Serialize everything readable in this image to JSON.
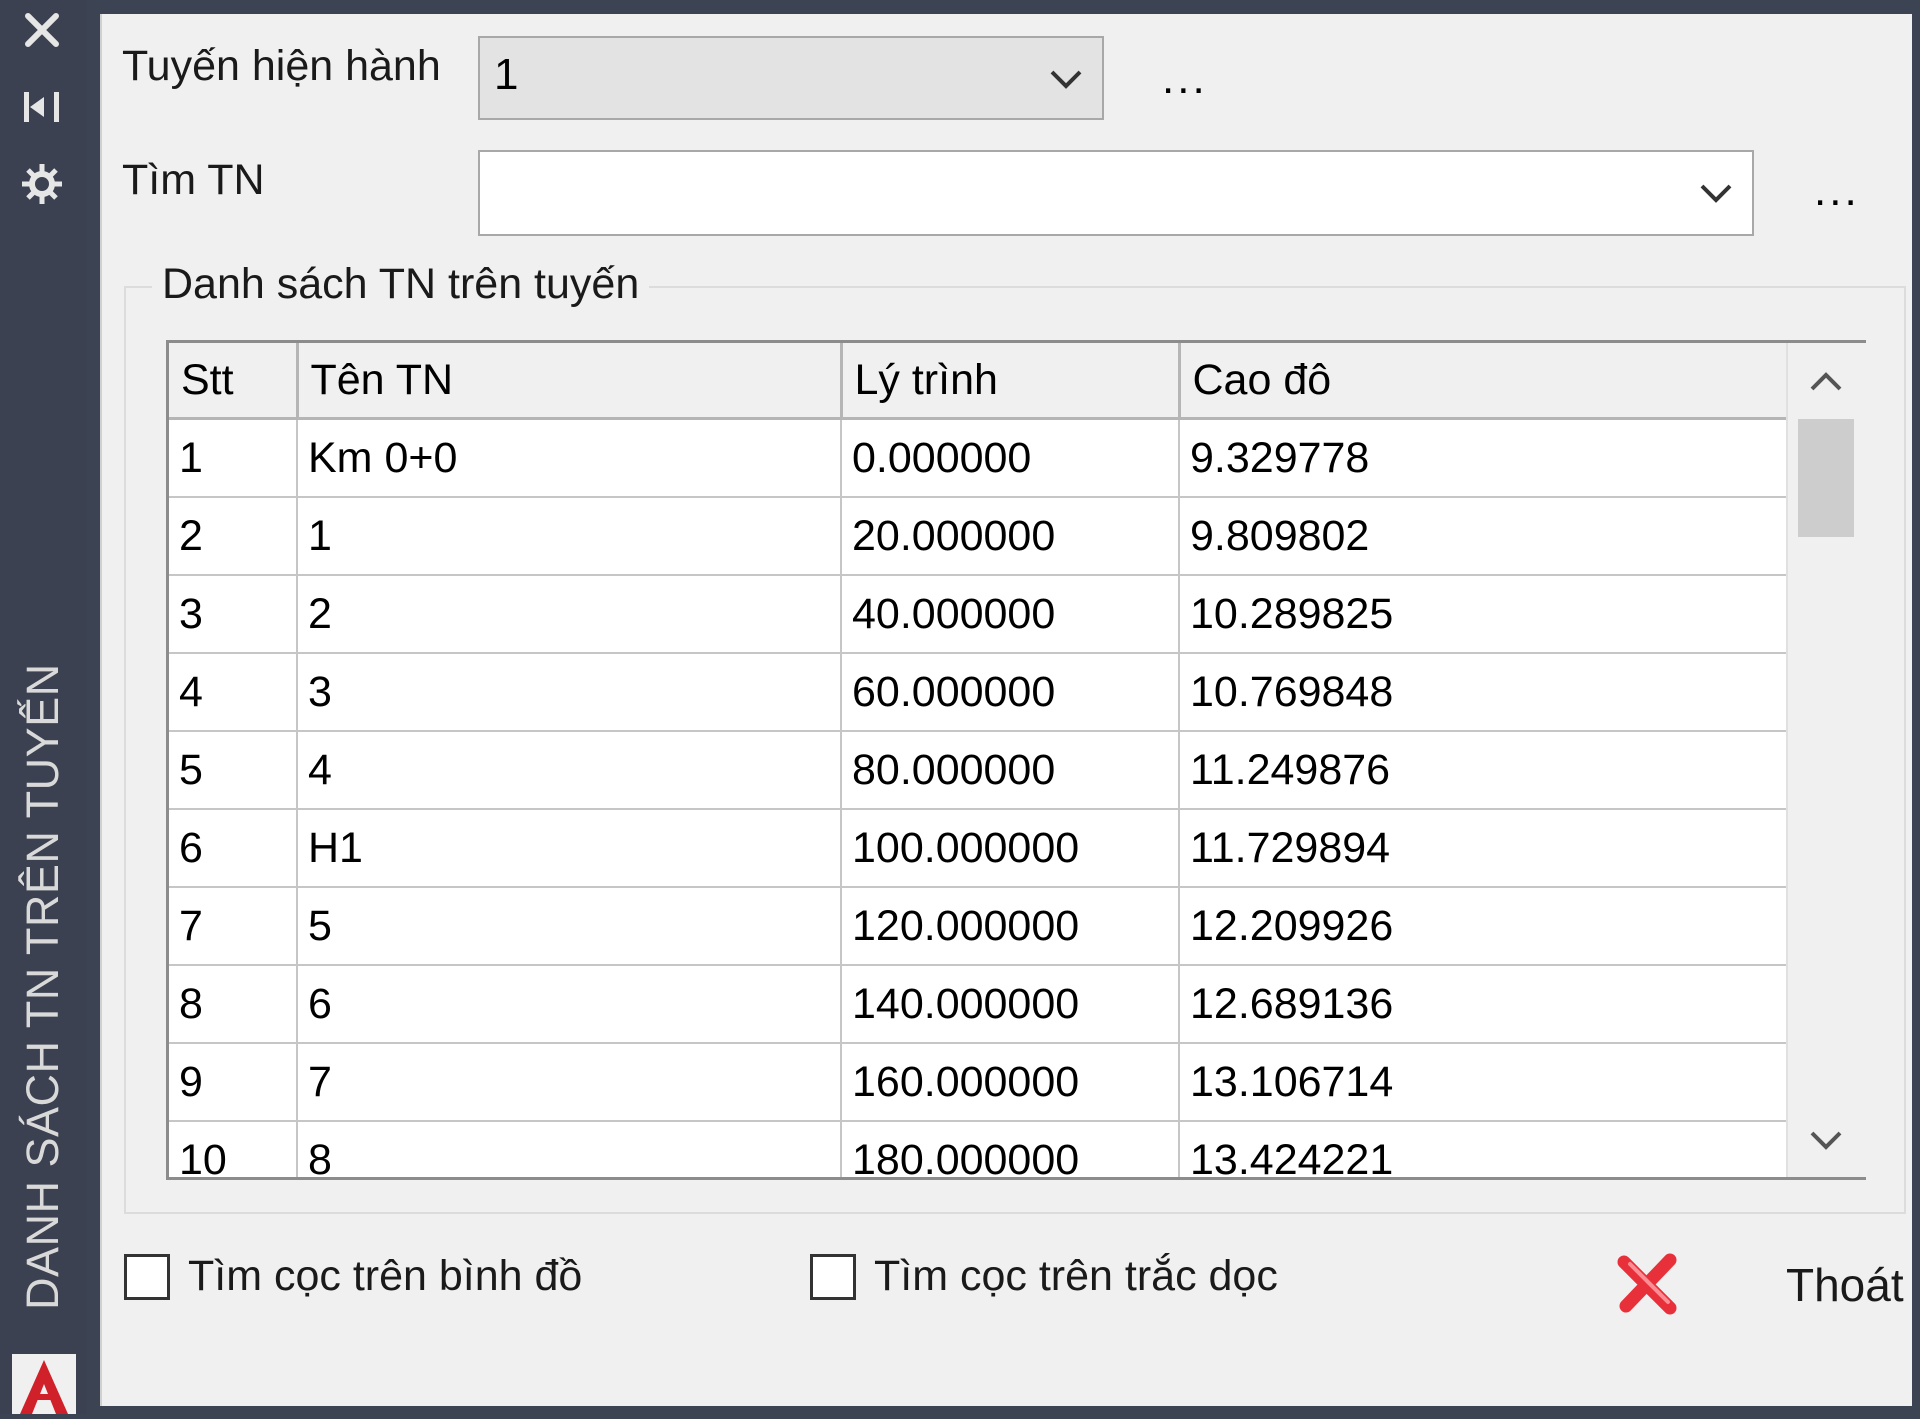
{
  "palette": {
    "title": "DANH SÁCH TN TRÊN TUYẾN",
    "close_icon": "close-icon",
    "autohide_icon": "autohide-icon",
    "properties_icon": "properties-icon"
  },
  "form": {
    "route_label": "Tuyến hiện hành",
    "route_value": "1",
    "route_more": "...",
    "search_label": "Tìm TN",
    "search_value": "",
    "search_more": "..."
  },
  "group": {
    "title": "Danh sách TN trên tuyến"
  },
  "table": {
    "columns": [
      "Stt",
      "Tên TN",
      "Lý trình",
      "Cao đô"
    ],
    "rows": [
      [
        "1",
        "Km 0+0",
        "0.000000",
        "9.329778"
      ],
      [
        "2",
        "1",
        "20.000000",
        "9.809802"
      ],
      [
        "3",
        "2",
        "40.000000",
        "10.289825"
      ],
      [
        "4",
        "3",
        "60.000000",
        "10.769848"
      ],
      [
        "5",
        "4",
        "80.000000",
        "11.249876"
      ],
      [
        "6",
        "H1",
        "100.000000",
        "11.729894"
      ],
      [
        "7",
        "5",
        "120.000000",
        "12.209926"
      ],
      [
        "8",
        "6",
        "140.000000",
        "12.689136"
      ],
      [
        "9",
        "7",
        "160.000000",
        "13.106714"
      ],
      [
        "10",
        "8",
        "180.000000",
        "13.424221"
      ]
    ]
  },
  "footer": {
    "check_plan": "Tìm cọc trên bình đồ",
    "check_profile": "Tìm cọc trên trắc dọc",
    "exit_label": "Thoát"
  },
  "colors": {
    "strip_bg": "#3b4150",
    "panel_bg": "#f0f0f0",
    "exit_icon": "#e8303a"
  }
}
